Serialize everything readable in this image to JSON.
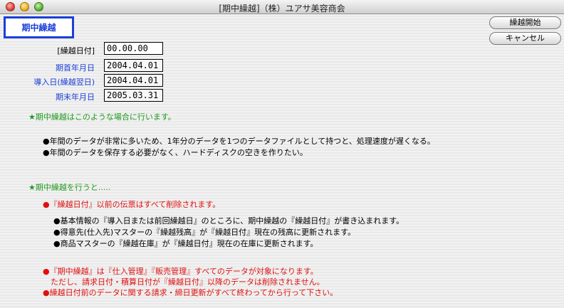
{
  "window": {
    "title": "[期中繰越]（株）ユアサ美容商会"
  },
  "mode_label": "期中繰越",
  "buttons": {
    "start": "繰越開始",
    "cancel": "キャンセル"
  },
  "fields": [
    {
      "label": "[繰越日付]",
      "value": "00.00.00",
      "editable": true
    },
    {
      "label": "期首年月日",
      "value": "2004.04.01",
      "editable": false
    },
    {
      "label": "導入日(繰越翌日)",
      "value": "2004.04.01",
      "editable": false
    },
    {
      "label": "期末年月日",
      "value": "2005.03.31",
      "editable": false
    }
  ],
  "section1": {
    "heading": "★期中繰越はこのような場合に行います。",
    "bullets": [
      "●年間のデータが非常に多いため、1年分のデータを1つのデータファイルとして持つと、処理速度が遅くなる。",
      "●年間のデータを保存する必要がなく、ハードディスクの空きを作りたい。"
    ]
  },
  "section2": {
    "heading": "★期中繰越を行うと.....",
    "warning": "●『繰越日付』以前の伝票はすべて削除されます。",
    "bullets": [
      "●基本情報の『導入日または前回繰越日』のところに、期中繰越の『繰越日付』が書き込まれます。",
      "●得意先(仕入先)マスターの『繰越残高』が『繰越日付』現在の残高に更新されます。",
      "●商品マスターの『繰越在庫』が『繰越日付』現在の在庫に更新されます。"
    ]
  },
  "notes": [
    "●『期中繰越』は『仕入管理』『販売管理』すべてのデータが対象になります。",
    "　ただし、請求日付・積算日付が『繰越日付』以降のデータは削除されません。",
    "●繰越日付前のデータに関する請求・締日更新がすべて終わってから行って下さい。"
  ],
  "colors": {
    "accent": "#1b3fd8",
    "heading": "#1f9a1f",
    "warning": "#e01010"
  }
}
